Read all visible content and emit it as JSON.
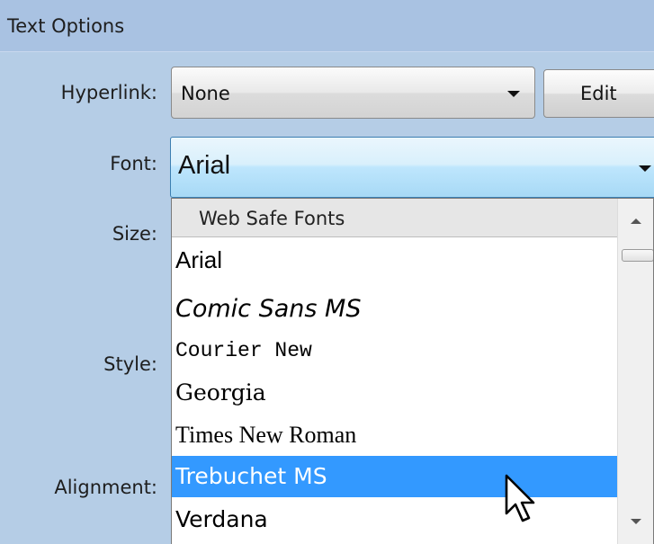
{
  "panel": {
    "title": "Text Options"
  },
  "labels": {
    "hyperlink": "Hyperlink:",
    "font": "Font:",
    "size": "Size:",
    "style": "Style:",
    "alignment": "Alignment:"
  },
  "hyperlink": {
    "value": "None",
    "edit_label": "Edit"
  },
  "font": {
    "value": "Arial"
  },
  "dropdown": {
    "group": "Web Safe Fonts",
    "options": [
      {
        "label": "Arial",
        "selected": false
      },
      {
        "label": "Comic Sans MS",
        "selected": false
      },
      {
        "label": "Courier New",
        "selected": false
      },
      {
        "label": "Georgia",
        "selected": false
      },
      {
        "label": "Times New Roman",
        "selected": false
      },
      {
        "label": "Trebuchet MS",
        "selected": true
      },
      {
        "label": "Verdana",
        "selected": false
      }
    ]
  },
  "colors": {
    "panel_bg": "#b5cde6",
    "header_bg": "#a9c2e2",
    "selection": "#3399ff"
  }
}
